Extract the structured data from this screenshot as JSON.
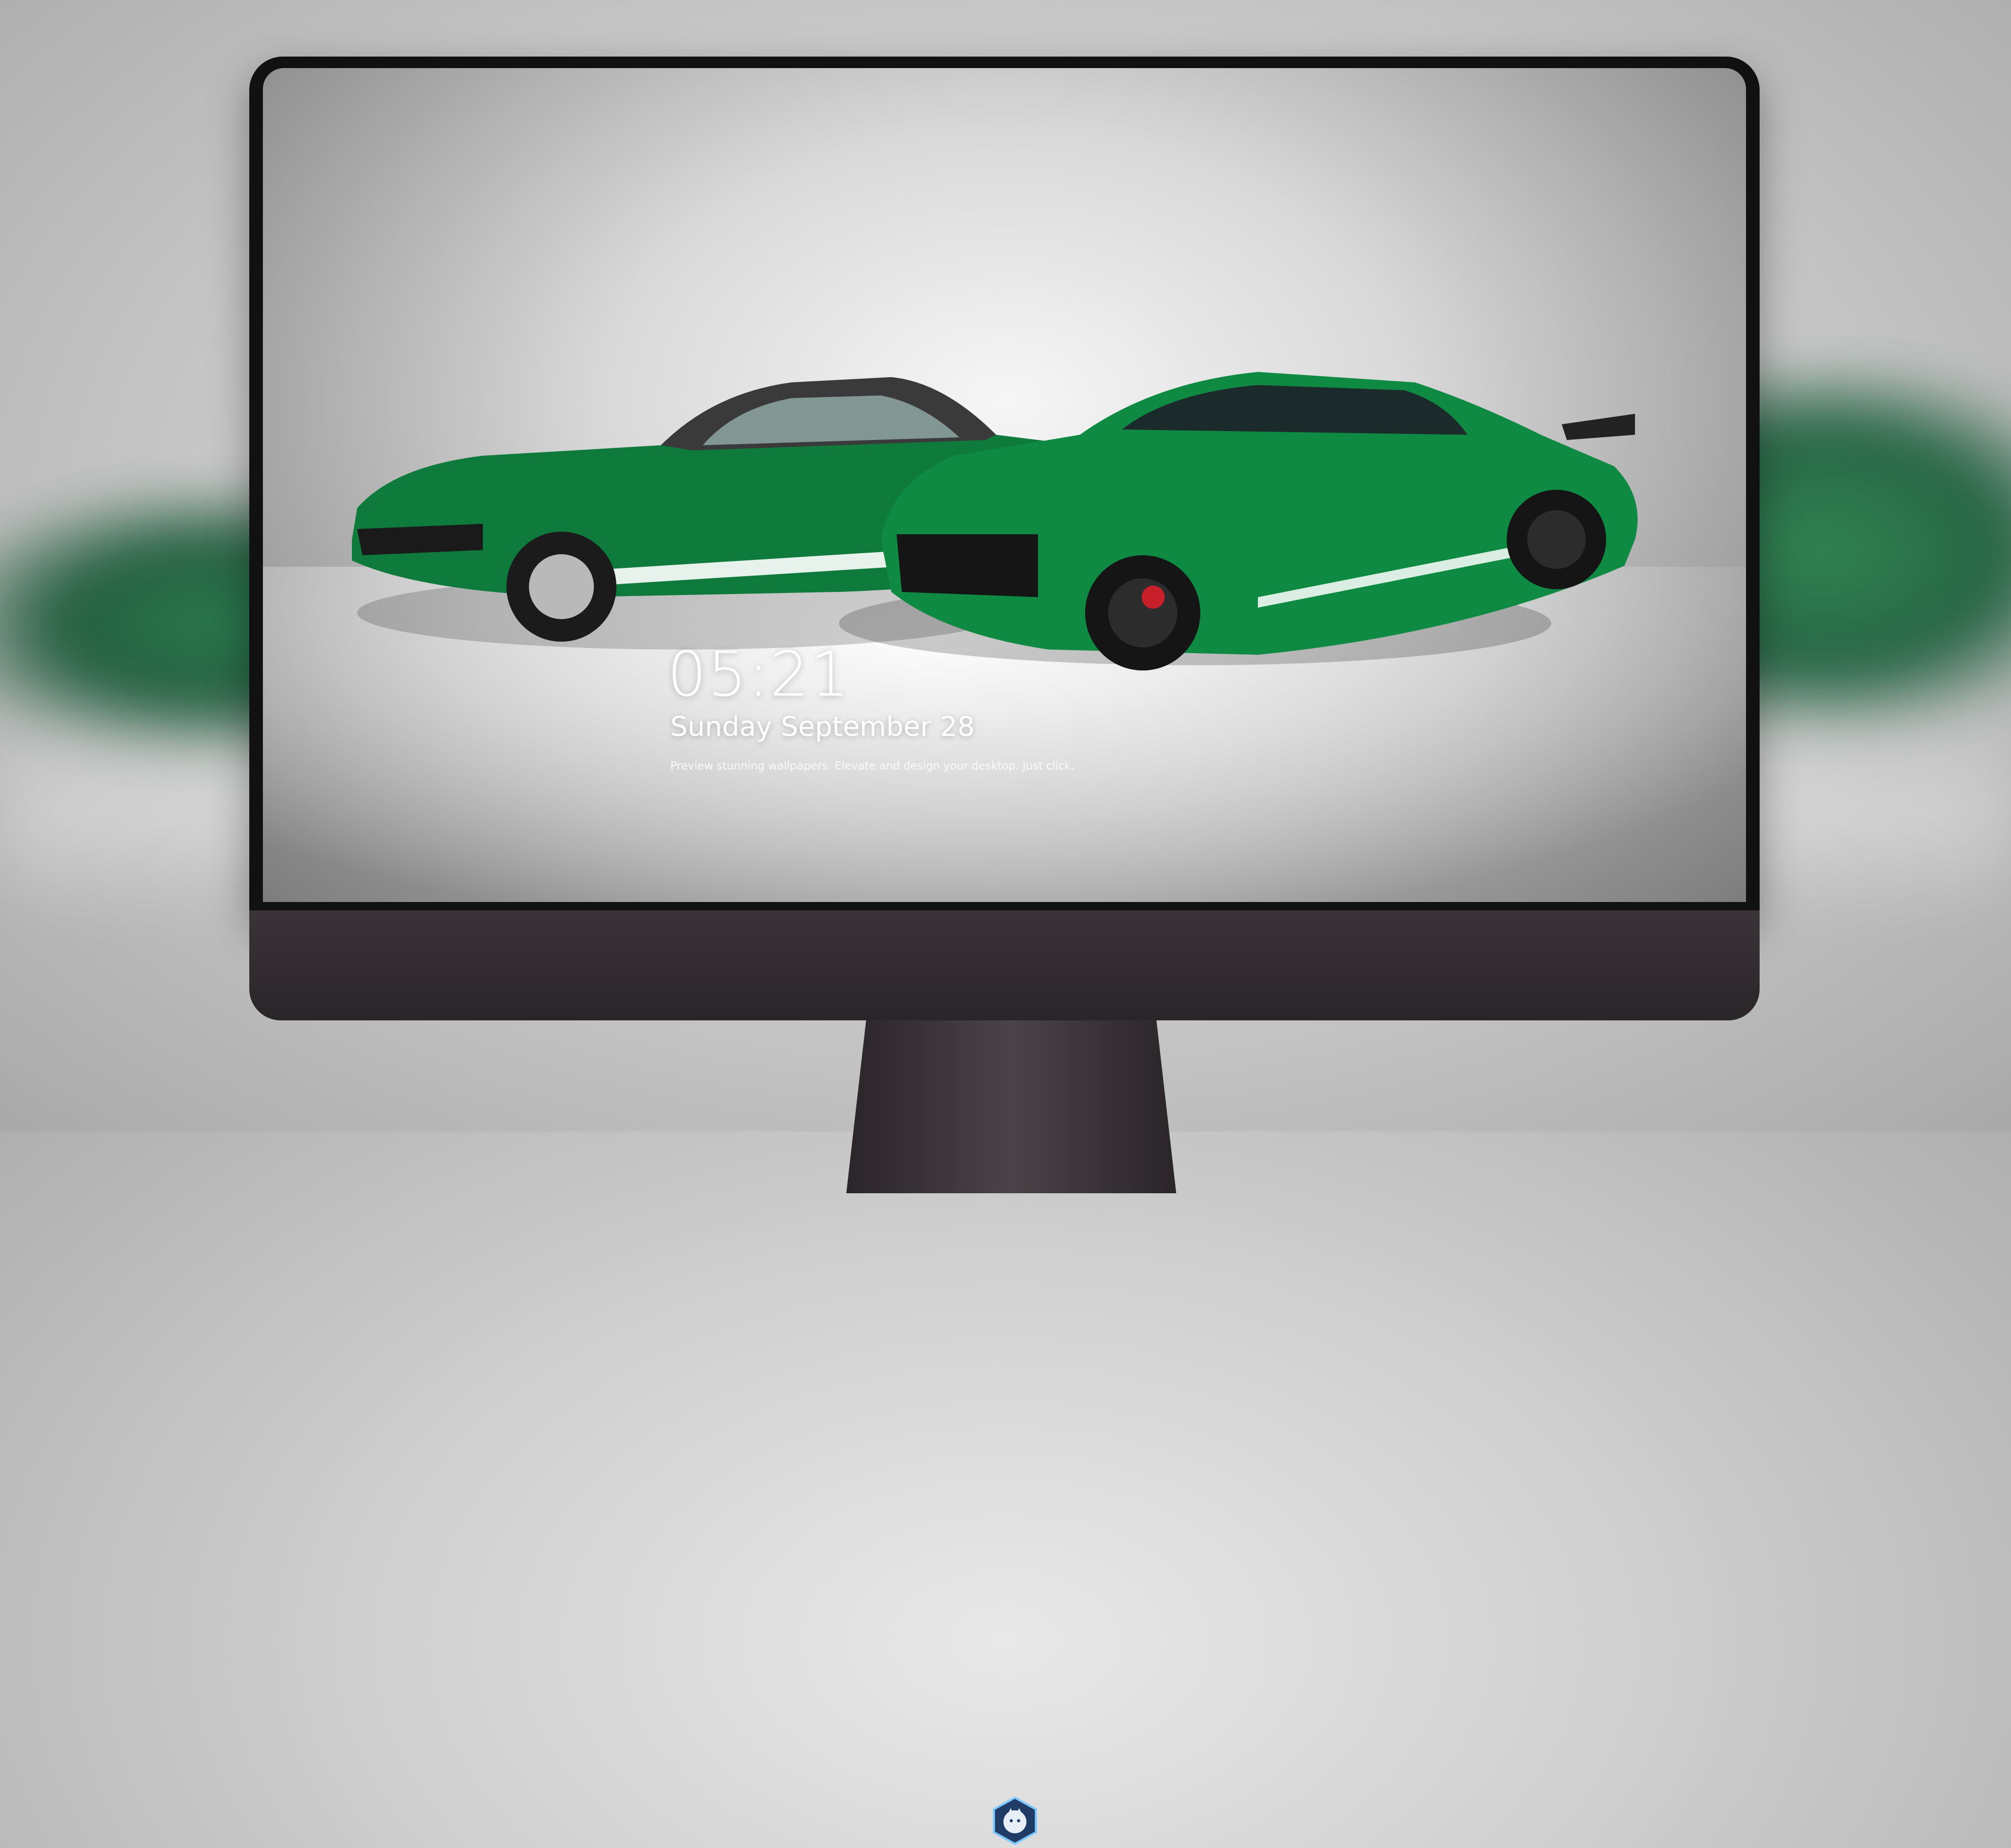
{
  "lockscreen": {
    "time": "05:21",
    "date": "Sunday September 28",
    "subtitle": "Preview stunning wallpapers. Elevate and design your desktop. Just click."
  },
  "dock": {
    "apps": [
      {
        "name": "messages-icon",
        "color": "#34c759"
      },
      {
        "name": "weather-icon",
        "color": "#2f8cf5"
      },
      {
        "name": "clock-icon",
        "color": "#ffffff"
      },
      {
        "name": "preview-icon",
        "color": "#f0c34b"
      },
      {
        "name": "claquette-icon",
        "color": "#4fb7e6"
      },
      {
        "name": "notes-icon",
        "color": "#ffd54a"
      },
      {
        "name": "app-grid-icon",
        "color": "#e84d3d"
      },
      {
        "name": "music-icon",
        "color": "#e34bd1"
      },
      {
        "name": "app-store-icon",
        "color": "#1e88f5"
      },
      {
        "name": "camera-icon",
        "color": "#6d6d6d"
      }
    ]
  },
  "colors": {
    "car_green": "#0d7a3d",
    "car_dark": "#0a4f27",
    "bezel": "#111111",
    "chin": "#2f2a2d"
  }
}
